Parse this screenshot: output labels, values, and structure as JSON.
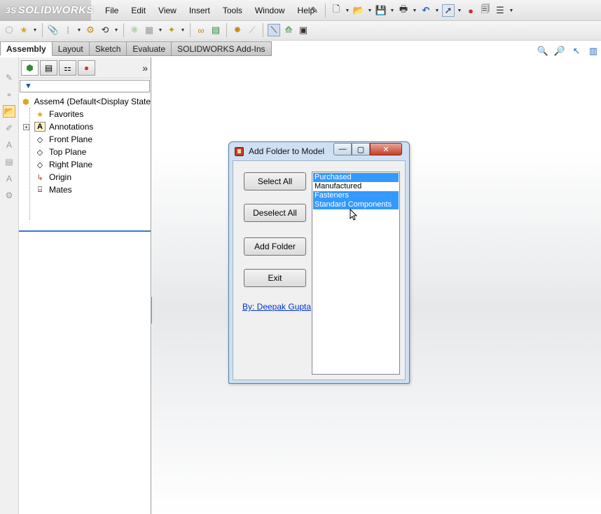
{
  "app": {
    "brand": "SOLIDWORKS",
    "brand_prefix": "3S"
  },
  "menu": [
    "File",
    "Edit",
    "View",
    "Insert",
    "Tools",
    "Window",
    "Help"
  ],
  "command_tabs": [
    "Assembly",
    "Layout",
    "Sketch",
    "Evaluate",
    "SOLIDWORKS Add-Ins"
  ],
  "active_tab": "Assembly",
  "feature_tree": {
    "filter_icon": "filter-icon",
    "root": "Assem4  (Default<Display State",
    "items": [
      "Favorites",
      "Annotations",
      "Front Plane",
      "Top Plane",
      "Right Plane",
      "Origin",
      "Mates"
    ]
  },
  "dialog": {
    "title": "Add Folder to Model",
    "buttons": [
      "Select All",
      "Deselect All",
      "Add Folder",
      "Exit"
    ],
    "author_link": "By: Deepak Gupta",
    "list_items": [
      {
        "label": "Purchased",
        "selected": true
      },
      {
        "label": "Manufactured",
        "selected": false
      },
      {
        "label": "Fasteners",
        "selected": true
      },
      {
        "label": "Standard Components",
        "selected": true
      }
    ]
  },
  "colors": {
    "selection": "#3399ff",
    "dialog_frame": "#cfe0f2",
    "close_button": "#c4402b",
    "link": "#0033cc"
  }
}
